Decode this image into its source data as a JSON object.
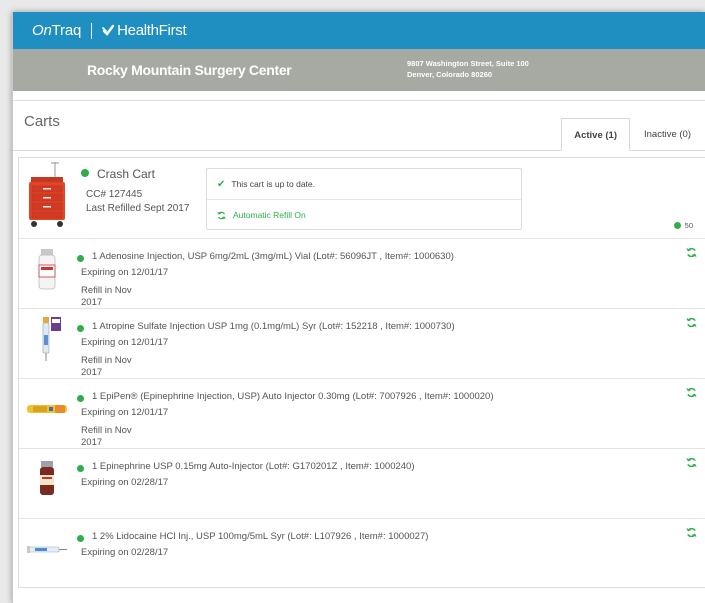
{
  "brand": {
    "ontraq_prefix": "On",
    "ontraq_suffix": "Traq",
    "healthfirst": "HealthFirst"
  },
  "facility": {
    "name": "Rocky Mountain Surgery Center",
    "address_line1": "9807 Washington Street, Suite 100",
    "address_line2": "Denver, Colorado 80260"
  },
  "carts": {
    "title": "Carts",
    "tabs": [
      {
        "label": "Active (1)",
        "active": true
      },
      {
        "label": "Inactive (0)",
        "active": false
      }
    ]
  },
  "cart": {
    "name": "Crash Cart",
    "cc": "CC# 127445",
    "last_refilled": "Last Refilled Sept 2017",
    "status_text": "This cart is up to date.",
    "refill_text": "Automatic Refill On",
    "count": "50"
  },
  "items": [
    {
      "name": "1 Adenosine Injection, USP 6mg/2mL (3mg/mL) Vial  (Lot#: 56096JT , Item#: 1000630)",
      "expiring": "Expiring on 12/01/17",
      "refill_line1": "Refill in Nov",
      "refill_line2": "2017",
      "icon": "vial-image"
    },
    {
      "name": "1 Atropine Sulfate Injection USP 1mg (0.1mg/mL) Syr (Lot#: 152218 , Item#: 1000730)",
      "expiring": "Expiring on 12/01/17",
      "refill_line1": "Refill in Nov",
      "refill_line2": "2017",
      "icon": "syringe-image"
    },
    {
      "name": "1 EpiPen® (Epinephrine Injection, USP) Auto Injector 0.30mg  (Lot#: 7007926 , Item#: 1000020)",
      "expiring": "Expiring on 12/01/17",
      "refill_line1": "Refill in Nov",
      "refill_line2": "2017",
      "icon": "auto-injector-image"
    },
    {
      "name": "1 Epinephrine USP 0.15mg Auto-Injector  (Lot#: G170201Z , Item#: 1000240)",
      "expiring": "Expiring on 02/28/17",
      "refill_line1": "",
      "refill_line2": "",
      "icon": "small-vial-image"
    },
    {
      "name": "1 2% Lidocaine HCl Inj., USP 100mg/5mL Syr (Lot#: L107926 , Item#: 1000027)",
      "expiring": "Expiring on 02/28/17",
      "refill_line1": "",
      "refill_line2": "",
      "icon": "prefilled-syringe-image"
    }
  ],
  "colors": {
    "brand_blue": "#1f8fc2",
    "subbar_gray": "#a7a9a3",
    "status_green": "#2eae4a",
    "cart_red": "#e0452b"
  }
}
